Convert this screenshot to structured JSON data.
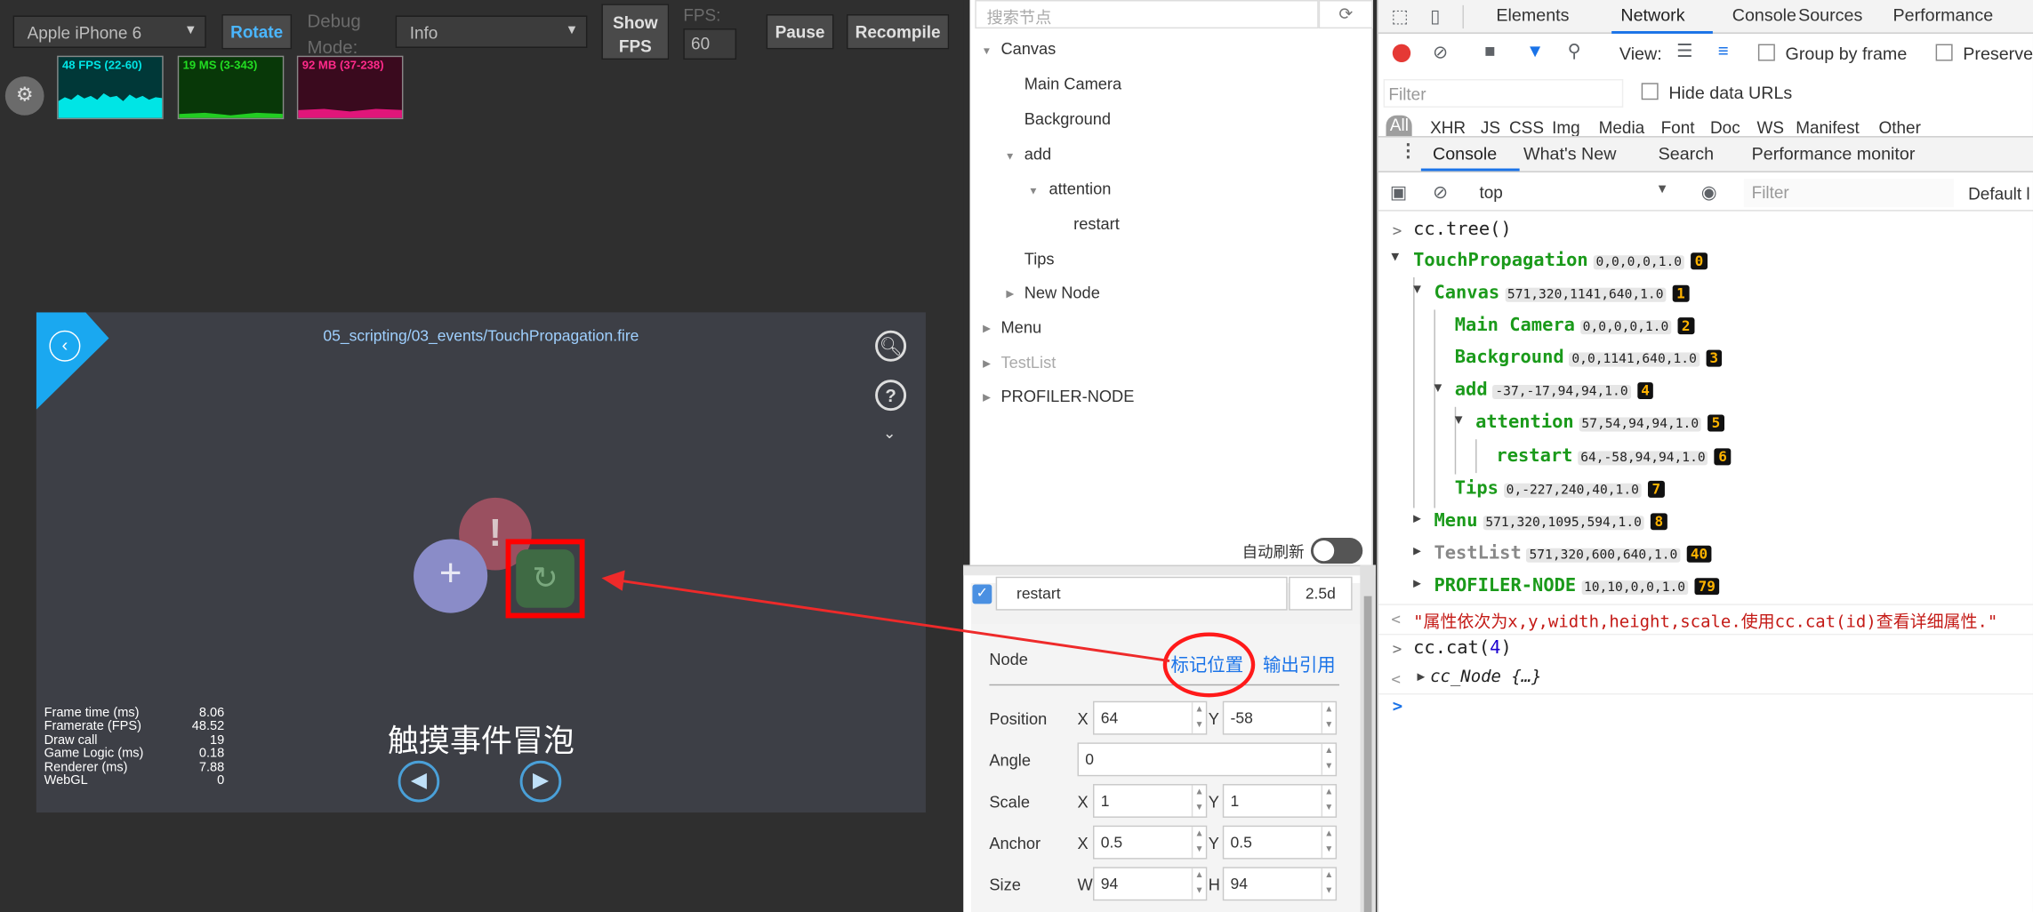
{
  "sim": {
    "device": "Apple iPhone 6",
    "rotate": "Rotate",
    "debug_mode_label": "Debug Mode:",
    "debug_mode": "Info",
    "show_fps": [
      "Show",
      "FPS"
    ],
    "fps_label": "FPS:",
    "fps_value": "60",
    "pause": "Pause",
    "recompile": "Recompile",
    "graphs": [
      {
        "label": "48 FPS (22-60)",
        "color": "#00e5e5"
      },
      {
        "label": "19 MS (3-343)",
        "color": "#22cc22"
      },
      {
        "label": "92 MB (37-238)",
        "color": "#e0167a"
      }
    ],
    "scene_path": "05_scripting/03_events/TouchPropagation.fire",
    "caption": "触摸事件冒泡",
    "stats": {
      "labels": [
        "Frame time (ms)",
        "Framerate (FPS)",
        "Draw call",
        "Game Logic (ms)",
        "Renderer (ms)",
        "WebGL"
      ],
      "values": [
        "8.06",
        "48.52",
        "19",
        "0.18",
        "7.88",
        "0"
      ]
    }
  },
  "hierarchy": {
    "search_placeholder": "搜索节点",
    "nodes": [
      "Canvas",
      "Main Camera",
      "Background",
      "add",
      "attention",
      "restart",
      "Tips",
      "New Node",
      "Menu",
      "TestList",
      "PROFILER-NODE"
    ],
    "auto_refresh": "自动刷新"
  },
  "inspector": {
    "node_name": "restart",
    "mode": "2.5d",
    "section": "Node",
    "mark_position": "标记位置",
    "output_ref": "输出引用",
    "position": {
      "label": "Position",
      "x": "64",
      "y": "-58"
    },
    "angle": {
      "label": "Angle",
      "v": "0"
    },
    "scale": {
      "label": "Scale",
      "x": "1",
      "y": "1"
    },
    "anchor": {
      "label": "Anchor",
      "x": "0.5",
      "y": "0.5"
    },
    "size": {
      "label": "Size",
      "w": "94",
      "h": "94"
    },
    "axis": {
      "x": "X",
      "y": "Y",
      "w": "W",
      "h": "H"
    }
  },
  "devtools": {
    "tabs": [
      "Elements",
      "Network",
      "Console",
      "Sources",
      "Performance"
    ],
    "view_label": "View:",
    "group_by_frame": "Group by frame",
    "preserve": "Preserve",
    "filter_placeholder": "Filter",
    "hide_data_urls": "Hide data URLs",
    "type_filters": [
      "All",
      "XHR",
      "JS",
      "CSS",
      "Img",
      "Media",
      "Font",
      "Doc",
      "WS",
      "Manifest",
      "Other"
    ],
    "drawer_tabs": [
      "Console",
      "What's New",
      "Search",
      "Performance monitor"
    ],
    "context": "top",
    "console_filter": "Filter",
    "levels": "Default l",
    "cmd1": "cc.tree()",
    "tree": [
      {
        "name": "TouchPropagation",
        "attrs": "0,0,0,0,1.0",
        "id": "0"
      },
      {
        "name": "Canvas",
        "attrs": "571,320,1141,640,1.0",
        "id": "1"
      },
      {
        "name": "Main Camera",
        "attrs": "0,0,0,0,1.0",
        "id": "2"
      },
      {
        "name": "Background",
        "attrs": "0,0,1141,640,1.0",
        "id": "3"
      },
      {
        "name": "add",
        "attrs": "-37,-17,94,94,1.0",
        "id": "4"
      },
      {
        "name": "attention",
        "attrs": "57,54,94,94,1.0",
        "id": "5"
      },
      {
        "name": "restart",
        "attrs": "64,-58,94,94,1.0",
        "id": "6"
      },
      {
        "name": "Tips",
        "attrs": "0,-227,240,40,1.0",
        "id": "7"
      },
      {
        "name": "Menu",
        "attrs": "571,320,1095,594,1.0",
        "id": "8"
      },
      {
        "name": "TestList",
        "attrs": "571,320,600,640,1.0",
        "id": "40"
      },
      {
        "name": "PROFILER-NODE",
        "attrs": "10,10,0,0,1.0",
        "id": "79"
      }
    ],
    "return_msg": "\"属性依次为x,y,width,height,scale.使用cc.cat(id)查看详细属性.\"",
    "cmd2": "cc.cat(",
    "cmd2_arg": "4",
    "cmd2_end": ")",
    "result": "cc_Node {…}"
  },
  "colors": {
    "accent": "#1a73e8",
    "highlight_box": "#ff0000",
    "node_green": "#1a9a1a",
    "id_badge": "#ffb300"
  }
}
